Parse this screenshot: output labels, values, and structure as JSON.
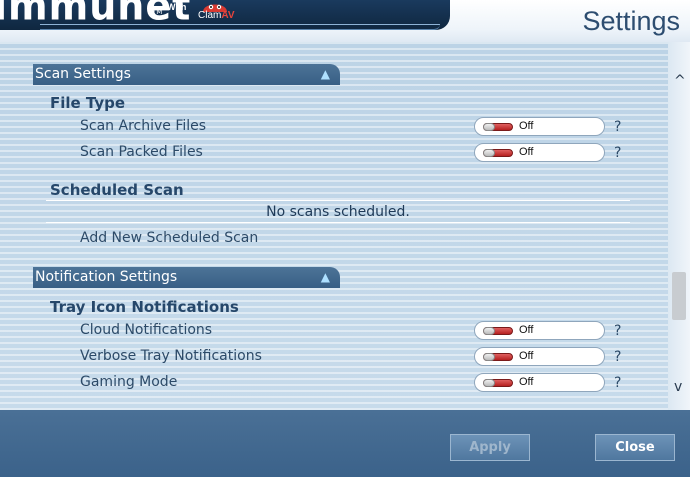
{
  "header": {
    "brand": "immunet",
    "trademark": "TM",
    "with_label": "With",
    "partner_prefix": "Clam",
    "partner_suffix": "AV",
    "page_title": "Settings"
  },
  "scan_settings": {
    "title": "Scan Settings",
    "toggle_glyph": "▲",
    "file_type": {
      "title": "File Type",
      "items": [
        {
          "label": "Scan Archive Files",
          "state": "Off",
          "help": "?"
        },
        {
          "label": "Scan Packed Files",
          "state": "Off",
          "help": "?"
        }
      ]
    },
    "scheduled_scan": {
      "title": "Scheduled Scan",
      "empty_message": "No scans scheduled.",
      "add_link": "Add New Scheduled Scan"
    }
  },
  "notification_settings": {
    "title": "Notification Settings",
    "toggle_glyph": "▲",
    "tray_icon": {
      "title": "Tray Icon Notifications",
      "items": [
        {
          "label": "Cloud Notifications",
          "state": "Off",
          "help": "?"
        },
        {
          "label": "Verbose Tray Notifications",
          "state": "Off",
          "help": "?"
        },
        {
          "label": "Gaming Mode",
          "state": "Off",
          "help": "?"
        }
      ]
    }
  },
  "scrollbar": {
    "up_glyph": "^",
    "down_glyph": "v"
  },
  "footer": {
    "apply_label": "Apply",
    "close_label": "Close"
  },
  "colors": {
    "header_bar": "#1a3a5e",
    "section_bar": "#385f85",
    "panel_background": "#c7dbeb",
    "toggle_off": "#b52020",
    "footer": "#3b628a"
  },
  "icons": {
    "section_collapse": "triangle-up-icon",
    "partner_logo": "clamav-icon",
    "help": "question-mark-icon"
  }
}
